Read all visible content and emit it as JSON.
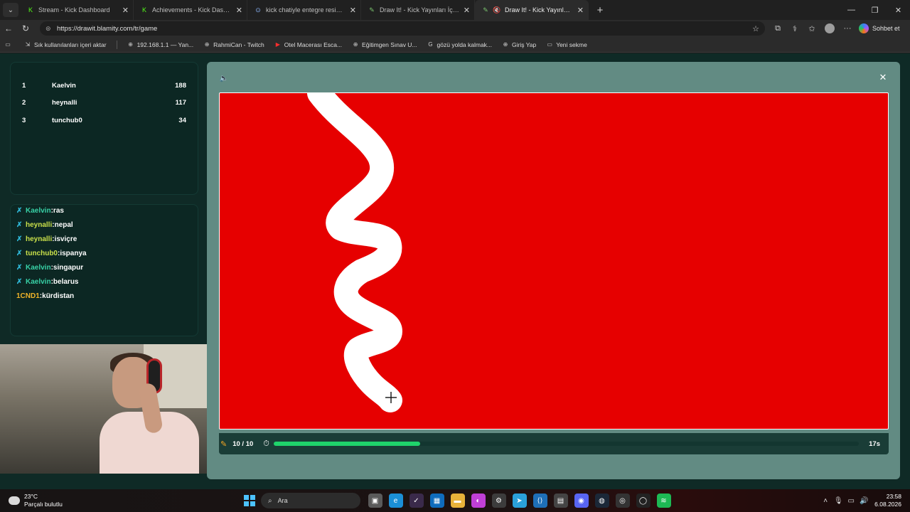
{
  "browser": {
    "tabs": [
      {
        "title": "Stream - Kick Dashboard",
        "icon": "kick-icon",
        "color": "#53fc18",
        "active": false
      },
      {
        "title": "Achievements - Kick Dashboard",
        "icon": "kick-icon",
        "color": "#53fc18",
        "active": false
      },
      {
        "title": "kick chatiyle entegre resim çizme",
        "icon": "google-icon",
        "color": "#8ab4f8",
        "active": false
      },
      {
        "title": "Draw It! - Kick Yayınları İçin Çizim",
        "icon": "blamity-icon",
        "color": "#7cc66f",
        "active": false
      },
      {
        "title": "Draw It! - Kick Yayınları İçin Çi",
        "icon": "blamity-icon",
        "color": "#7cc66f",
        "active": true
      }
    ],
    "url": "https://drawit.blamity.com/tr/game",
    "copilot_label": "Sohbet et",
    "bookmarks": [
      {
        "label": "Sık kullanılanları içeri aktar",
        "icon": "import-icon"
      },
      {
        "label": "192.168.1.1 — Yan...",
        "icon": "globe-icon"
      },
      {
        "label": "RahmiCan - Twitch",
        "icon": "globe-icon"
      },
      {
        "label": "Otel Macerası Esca...",
        "icon": "youtube-icon"
      },
      {
        "label": "Eğitimgen Sınav U...",
        "icon": "globe-icon"
      },
      {
        "label": "gözü yolda kalmak...",
        "icon": "google-icon"
      },
      {
        "label": "Giriş Yap",
        "icon": "globe-icon"
      },
      {
        "label": "Yeni sekme",
        "icon": "tab-icon"
      }
    ]
  },
  "leaderboard": [
    {
      "rank": "1",
      "name": "Kaelvin",
      "points": "188"
    },
    {
      "rank": "2",
      "name": "heynalli",
      "points": "117"
    },
    {
      "rank": "3",
      "name": "tunchub0",
      "points": "34"
    }
  ],
  "chat": [
    {
      "user": "Kaelvin",
      "message": "ras",
      "checked": true,
      "user_color": "cyan",
      "partial": true
    },
    {
      "user": "heynalli",
      "message": "nepal",
      "checked": true,
      "user_color": "yellow"
    },
    {
      "user": "heynalli",
      "message": "isviçre",
      "checked": true,
      "user_color": "yellow"
    },
    {
      "user": "tunchub0",
      "message": "ispanya",
      "checked": true,
      "user_color": "yellow"
    },
    {
      "user": "Kaelvin",
      "message": "singapur",
      "checked": true,
      "user_color": "cyan"
    },
    {
      "user": "Kaelvin",
      "message": "belarus",
      "checked": true,
      "user_color": "cyan"
    },
    {
      "user": "1CND1",
      "message": "kürdistan",
      "checked": false,
      "user_color": "orange"
    }
  ],
  "game": {
    "canvas_color": "#e60000",
    "stroke_color": "#ffffff",
    "round": "10 / 10",
    "time_left": "17s",
    "progress_fraction": 0.25,
    "progress_color": "#1fd36b"
  },
  "taskbar": {
    "weather_temp": "23°C",
    "weather_desc": "Parçalı bulutlu",
    "search_placeholder": "Ara",
    "time": "23:58",
    "date": "6.08.2026"
  }
}
